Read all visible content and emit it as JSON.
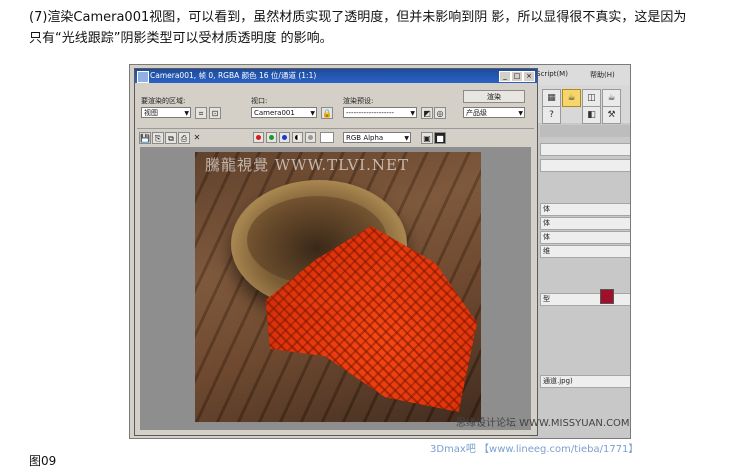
{
  "article": {
    "line1": "(7)渲染Camera001视图，可以看到，虽然材质实现了透明度，但并未影响到阴 影，所以显得很不真实，这是因为",
    "line2": "只有“光线跟踪”阴影类型可以受材质透明度 的影响。"
  },
  "render_window": {
    "title": "Camera001, 帧 0, RGBA 颜色 16 位/通道 (1:1)",
    "area_label": "要渲染的区域:",
    "area_value": "视图",
    "viewport_label": "视口:",
    "viewport_value": "Camera001",
    "preset_label": "渲染预设:",
    "preset_value": "-------------------",
    "render_button": "渲染",
    "product_value": "产品级",
    "channel_value": "RGB Alpha",
    "window_buttons": [
      "_",
      "□",
      "×"
    ]
  },
  "max_ui": {
    "menu_items": [
      "xScript(M)",
      "帮助(H)"
    ],
    "cmd_rows": [
      "体",
      "体",
      "体",
      "维",
      "型",
      "通道.jpg)"
    ]
  },
  "image_watermarks": {
    "top": "騰龍視覺 WWW.TLVI.NET",
    "bottom_right": "思缘设计论坛 WWW.MISSYUAN.COM",
    "bottom": "3Dmax吧 【www.lineeg.com/tieba/1771】"
  },
  "figure_caption": "图09",
  "colors": {
    "title_bar": "#1e4c9c",
    "cloth_red": "#e8340a",
    "swatch": "#a0102a"
  },
  "icons": [
    "save-icon",
    "copy-icon",
    "clone-icon",
    "print-icon",
    "close-icon",
    "red-channel-icon",
    "green-channel-icon",
    "blue-channel-icon",
    "mono-icon",
    "alpha-icon",
    "display-alpha-icon",
    "lock-icon",
    "grid-icon",
    "teapot-icon"
  ]
}
